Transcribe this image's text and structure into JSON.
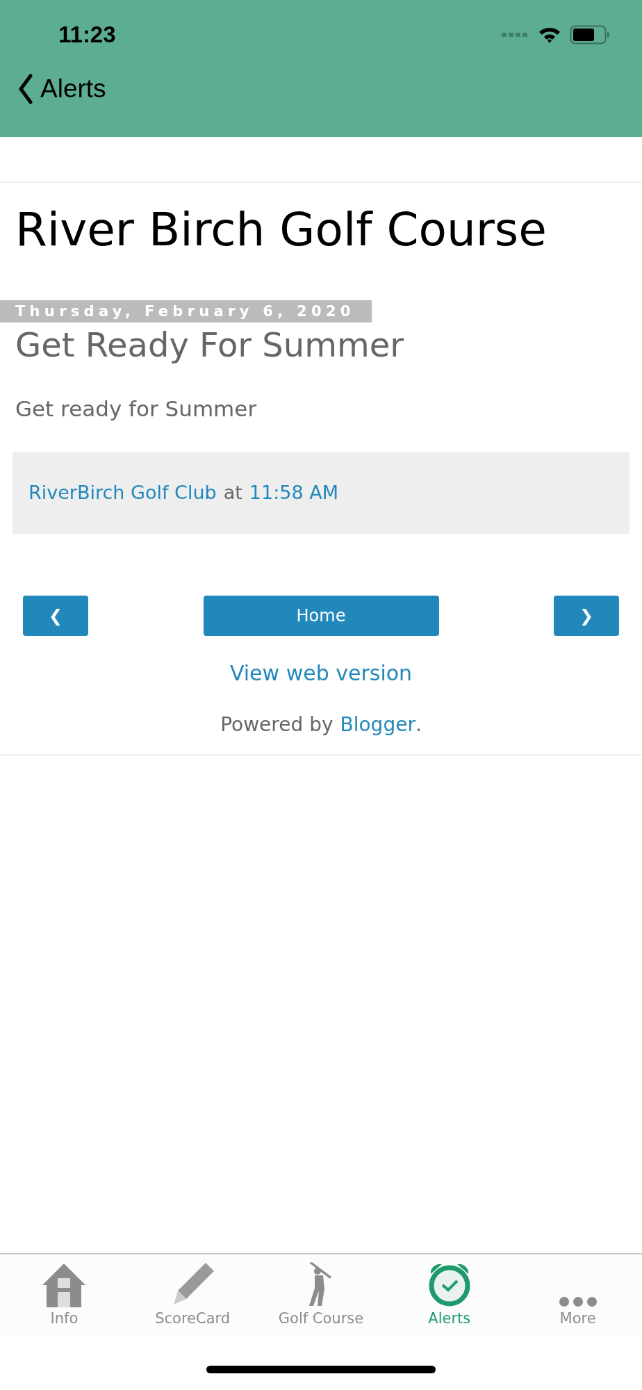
{
  "status_bar": {
    "time": "11:23"
  },
  "nav_bar": {
    "back_label": "Alerts"
  },
  "blog": {
    "title": "River Birch Golf Course",
    "post": {
      "date": "Thursday, February 6, 2020",
      "title": "Get Ready For Summer",
      "body": "Get ready for Summer",
      "footer": {
        "author": "RiverBirch Golf Club",
        "connector": "at",
        "time": "11:58 AM"
      }
    },
    "pager": {
      "prev": "❮",
      "home": "Home",
      "next": "❯"
    },
    "web_version_link": "View web version",
    "powered": {
      "text": "Powered by",
      "link": "Blogger",
      "end": "."
    }
  },
  "tabs": [
    {
      "label": "Info",
      "kind": "house",
      "selected": false
    },
    {
      "label": "ScoreCard",
      "kind": "pencil",
      "selected": false
    },
    {
      "label": "Golf Course",
      "kind": "golfer",
      "selected": false
    },
    {
      "label": "Alerts",
      "kind": "alarm",
      "selected": true
    },
    {
      "label": "More",
      "kind": "dots",
      "selected": false
    }
  ]
}
